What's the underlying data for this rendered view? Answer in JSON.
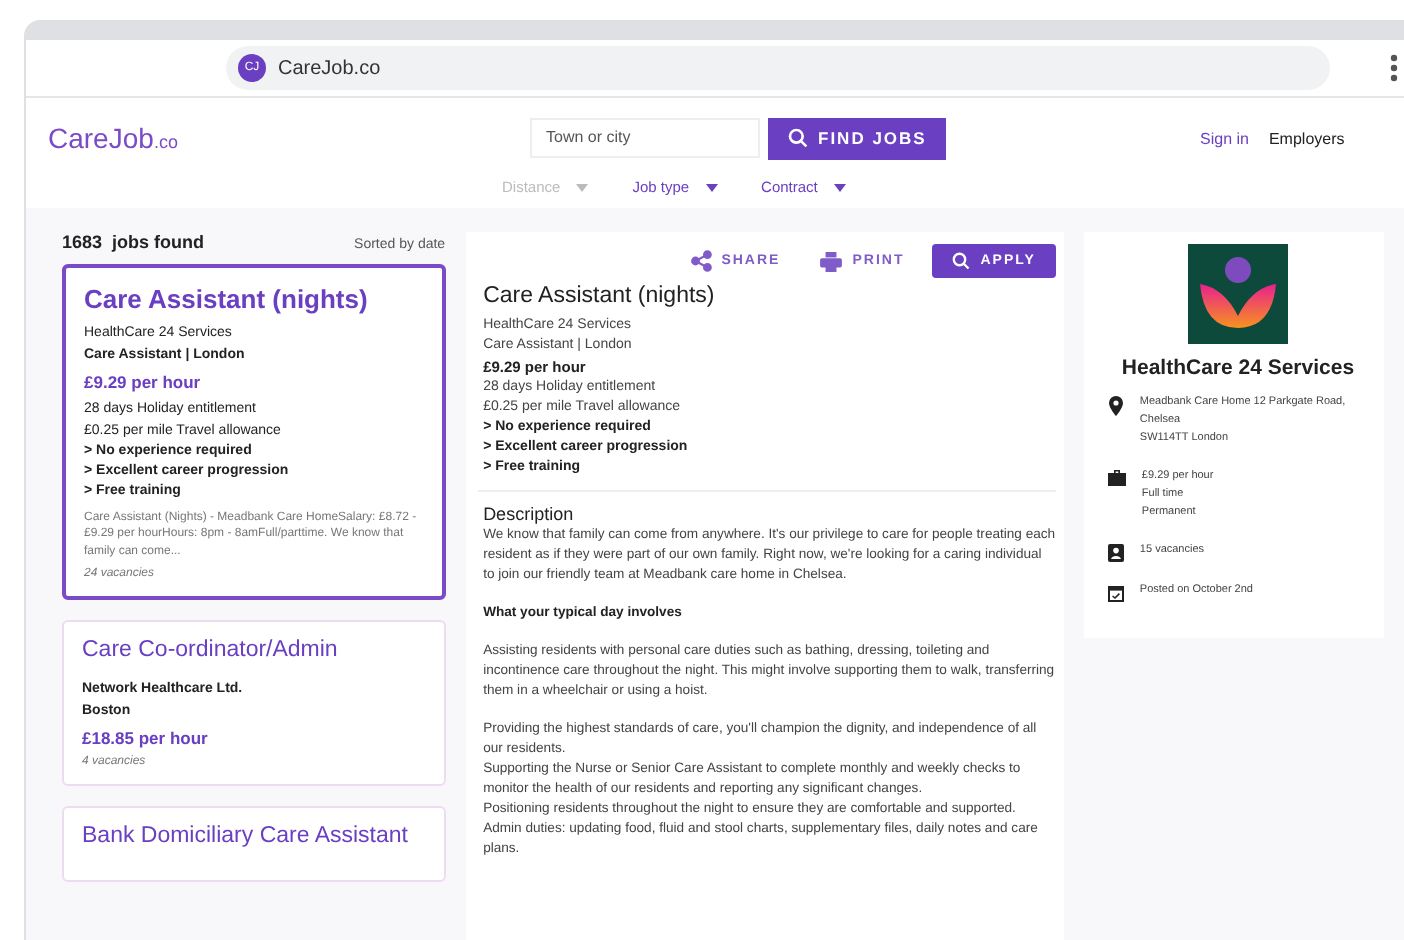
{
  "browser": {
    "favicon": "CJ",
    "url": "CareJob.co"
  },
  "header": {
    "logo": {
      "main": "Care",
      "accent": "Job",
      "suffix": ".co"
    },
    "search": {
      "placeholder": "Town or city"
    },
    "find_button": "FIND JOBS",
    "links": [
      "Sign in",
      "Employers"
    ],
    "filters": [
      {
        "label": "Distance",
        "disabled": true
      },
      {
        "label": "Job type",
        "disabled": false
      },
      {
        "label": "Contract",
        "disabled": false
      }
    ]
  },
  "results": {
    "count": "1683",
    "count_label": "jobs found",
    "sort": "Sorted by date",
    "jobs": [
      {
        "title": "Care Assistant (nights)",
        "lines": [
          "HealthCare 24 Services",
          "Care Assistant | London"
        ],
        "pay": "£9.29 per hour",
        "perks": [
          "28 days Holiday entitlement",
          "£0.25 per mile Travel allowance"
        ],
        "highlights": [
          "> No experience required",
          "> Excellent career progression",
          "> Free training"
        ],
        "snippet": "Care Assistant (Nights) - Meadbank Care HomeSalary:  £8.72 - £9.29 per hourHours: 8pm - 8amFull/parttime. We know that family can come...",
        "vacancies": "24 vacancies",
        "selected": true
      },
      {
        "title": "Care Co-ordinator/Admin",
        "lines": [
          "Network Healthcare Ltd.",
          "Boston"
        ],
        "pay": "£18.85 per hour",
        "vacancies": "4 vacancies",
        "selected": false
      },
      {
        "title": "Bank Domiciliary Care Assistant",
        "selected": false
      }
    ]
  },
  "detail": {
    "actions": [
      {
        "kind": "share",
        "label": "SHARE"
      },
      {
        "kind": "print",
        "label": "PRINT"
      },
      {
        "kind": "apply",
        "label": "APPLY"
      }
    ],
    "title": "Care Assistant (nights)",
    "company": "HealthCare 24 Services",
    "role_location": "Care Assistant | London",
    "pay": "£9.29 per hour",
    "perks": [
      "28 days Holiday entitlement",
      "£0.25 per mile Travel allowance"
    ],
    "highlights": [
      "> No experience required",
      "> Excellent career progression",
      "> Free training"
    ],
    "description_heading": "Description",
    "blocks": [
      {
        "kind": "text",
        "lines": [
          "We know that family can come from anywhere. It's our privilege to care for people treating each resident as if they were part of our own family. Right now, we're looking for a caring individual to join our friendly team at Meadbank care home in Chelsea."
        ]
      },
      {
        "kind": "heading",
        "lines": [
          "What your typical day involves"
        ]
      },
      {
        "kind": "text",
        "lines": [
          "Assisting residents with personal care duties such as bathing, dressing, toileting and incontinence care throughout the night. This might involve supporting them to walk, transferring them in a wheelchair or using a hoist."
        ]
      },
      {
        "kind": "text",
        "lines": [
          "Providing the highest standards of care, you'll champion the dignity, and independence of all our residents.",
          "Supporting the Nurse or Senior Care Assistant to complete monthly and weekly checks to monitor the health of our residents and reporting any significant changes.",
          "Positioning residents throughout the night to ensure they are comfortable and supported.",
          "Admin duties: updating food, fluid and stool charts, supplementary files, daily notes and care plans."
        ]
      }
    ]
  },
  "company": {
    "name": "HealthCare 24 Services",
    "facts": [
      {
        "kind": "location",
        "lines": [
          "Meadbank Care Home 12 Parkgate Road, Chelsea",
          "SW114TT London"
        ]
      },
      {
        "kind": "job",
        "lines": [
          "£9.29 per hour",
          "Full time",
          "Permanent"
        ]
      },
      {
        "kind": "vacancies",
        "lines": [
          "15 vacancies"
        ]
      },
      {
        "kind": "posted",
        "lines": [
          "Posted on October 2nd"
        ]
      }
    ]
  }
}
